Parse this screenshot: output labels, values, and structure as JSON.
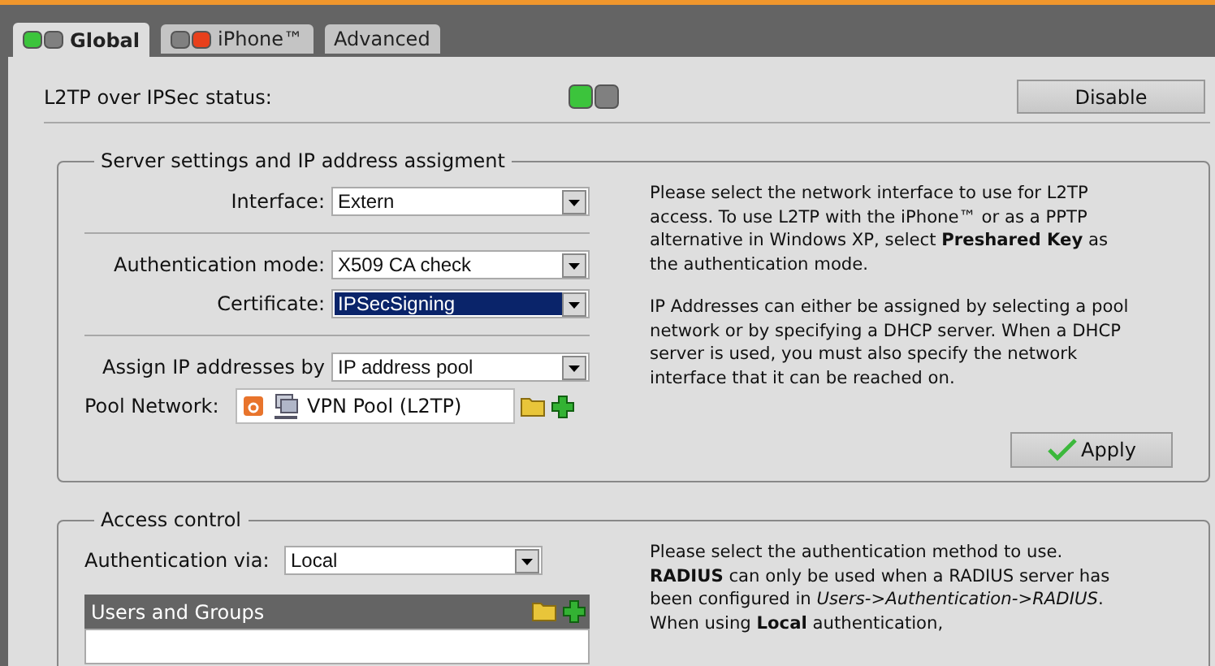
{
  "tabs": [
    {
      "label": "Global",
      "selected": true,
      "enabled": true
    },
    {
      "label": "iPhone™",
      "selected": false,
      "enabled": false
    },
    {
      "label": "Advanced",
      "selected": false
    }
  ],
  "status_row": {
    "label": "L2TP over IPSec status:",
    "enabled": true,
    "button": "Disable"
  },
  "server_settings": {
    "legend": "Server settings and IP address assigment",
    "groups": [
      [
        {
          "label": "Interface:",
          "value": "Extern",
          "focused": false
        }
      ],
      [
        {
          "label": "Authentication mode:",
          "value": "X509 CA check",
          "focused": false
        },
        {
          "label": "Certificate:",
          "value": "IPSecSigning",
          "focused": true
        }
      ],
      [
        {
          "label": "Assign IP addresses by",
          "value": "IP address pool",
          "focused": false
        }
      ]
    ],
    "pool": {
      "label": "Pool Network:",
      "value": "VPN Pool (L2TP)"
    },
    "help": [
      "Please select the network interface to use for L2TP access. To use L2TP with the iPhone™ or as a PPTP alternative in Windows XP, select **Preshared Key** as the authentication mode.",
      "IP Addresses can either be assigned by selecting a pool network or by specifying a DHCP server. When a DHCP server is used, you must also specify the network interface that it can be reached on."
    ],
    "apply": "Apply"
  },
  "access_control": {
    "legend": "Access control",
    "auth": {
      "label": "Authentication via:",
      "value": "Local",
      "focused": false
    },
    "list_header": "Users and Groups",
    "help": [
      "Please select the authentication method to use. **RADIUS** can only be used when a RADIUS server has been configured in *Users->Authentication->RADIUS*. When using **Local** authentication,"
    ]
  }
}
